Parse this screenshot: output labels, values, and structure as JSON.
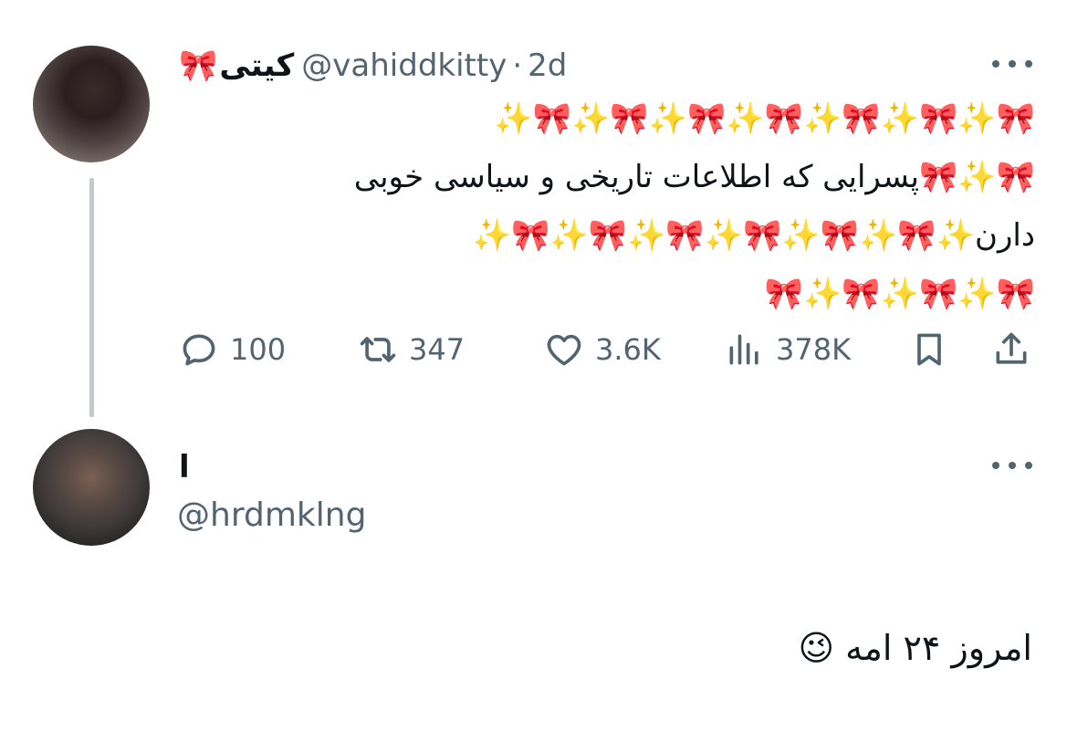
{
  "original_tweet": {
    "display_name": "کیتی",
    "name_emoji": "🎀",
    "handle": "@vahiddkitty",
    "separator": "·",
    "time": "2d",
    "text_lines": [
      "🎀✨🎀✨🎀✨🎀✨🎀✨🎀✨🎀✨",
      "🎀✨🎀پسرایی که اطلاعات تاریخی و سیاسی خوبی",
      "دارن✨🎀✨🎀✨🎀✨🎀✨🎀✨🎀✨",
      "🎀✨🎀✨🎀✨🎀"
    ],
    "stats": {
      "replies": "100",
      "retweets": "347",
      "likes": "3.6K",
      "views": "378K"
    },
    "icons": {
      "more": "more-icon",
      "reply": "reply-icon",
      "retweet": "retweet-icon",
      "like": "heart-icon",
      "views": "views-icon",
      "bookmark": "bookmark-icon",
      "share": "share-icon"
    }
  },
  "reply_tweet": {
    "display_name": "l",
    "handle": "@hrdmklng",
    "text": "امروز ۲۴ امه 😉"
  },
  "colors": {
    "secondary_text": "#536471",
    "primary_text": "#0f1419",
    "thread_line": "#c3c9cf"
  }
}
